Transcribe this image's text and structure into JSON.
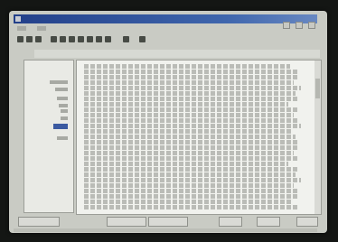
{
  "window": {
    "title": ""
  },
  "menubar": {
    "items": [
      "",
      ""
    ]
  },
  "toolbar": {
    "icons": [
      "back-icon",
      "forward-icon",
      "home-icon",
      "print-icon",
      "copy-icon",
      "search-icon",
      "zoom-icon",
      "options-icon",
      "help-icon",
      "bookmark-icon",
      "star-icon",
      "close-icon"
    ]
  },
  "doc_header": "",
  "nav": {
    "items": [
      "",
      "",
      "",
      "",
      "",
      "",
      "",
      ""
    ],
    "selected_index": 6
  },
  "document": {
    "lines": [
      "",
      "",
      "",
      "",
      "",
      "",
      "",
      "",
      "",
      "",
      "",
      "",
      "",
      "",
      "",
      "",
      "",
      "",
      "",
      "",
      "",
      "",
      "",
      "",
      "",
      "",
      ""
    ]
  },
  "buttons": [
    "",
    "",
    "",
    "",
    "",
    ""
  ],
  "status": ""
}
